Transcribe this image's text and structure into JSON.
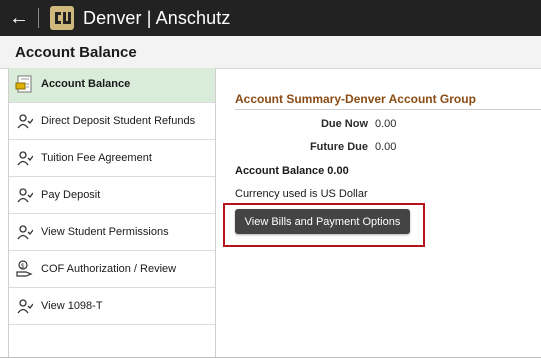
{
  "header": {
    "app_title": "Denver | Anschutz",
    "back_icon": "arrow-left-icon",
    "logo_icon": "cu-logo-icon"
  },
  "page": {
    "title": "Account Balance"
  },
  "sidebar": {
    "items": [
      {
        "label": "Account Balance",
        "icon": "account-balance-icon",
        "active": true
      },
      {
        "label": "Direct Deposit Student Refunds",
        "icon": "person-check-icon"
      },
      {
        "label": "Tuition Fee Agreement",
        "icon": "person-check-icon"
      },
      {
        "label": "Pay Deposit",
        "icon": "person-check-icon"
      },
      {
        "label": "View Student Permissions",
        "icon": "person-check-icon"
      },
      {
        "label": "COF Authorization / Review",
        "icon": "hand-money-icon"
      },
      {
        "label": "View 1098-T",
        "icon": "person-check-icon"
      }
    ]
  },
  "summary": {
    "group_title": "Account Summary-Denver Account Group",
    "due_now_label": "Due Now",
    "due_now_value": "0.00",
    "future_due_label": "Future Due",
    "future_due_value": "0.00",
    "balance_text": "Account Balance 0.00",
    "currency_text": "Currency used is US Dollar",
    "button_label": "View Bills and Payment Options"
  },
  "colors": {
    "topbar": "#222222",
    "active_item": "#d8ecd9",
    "group_title": "#8a4b14",
    "highlight": "#b5121b",
    "button": "#444444"
  }
}
